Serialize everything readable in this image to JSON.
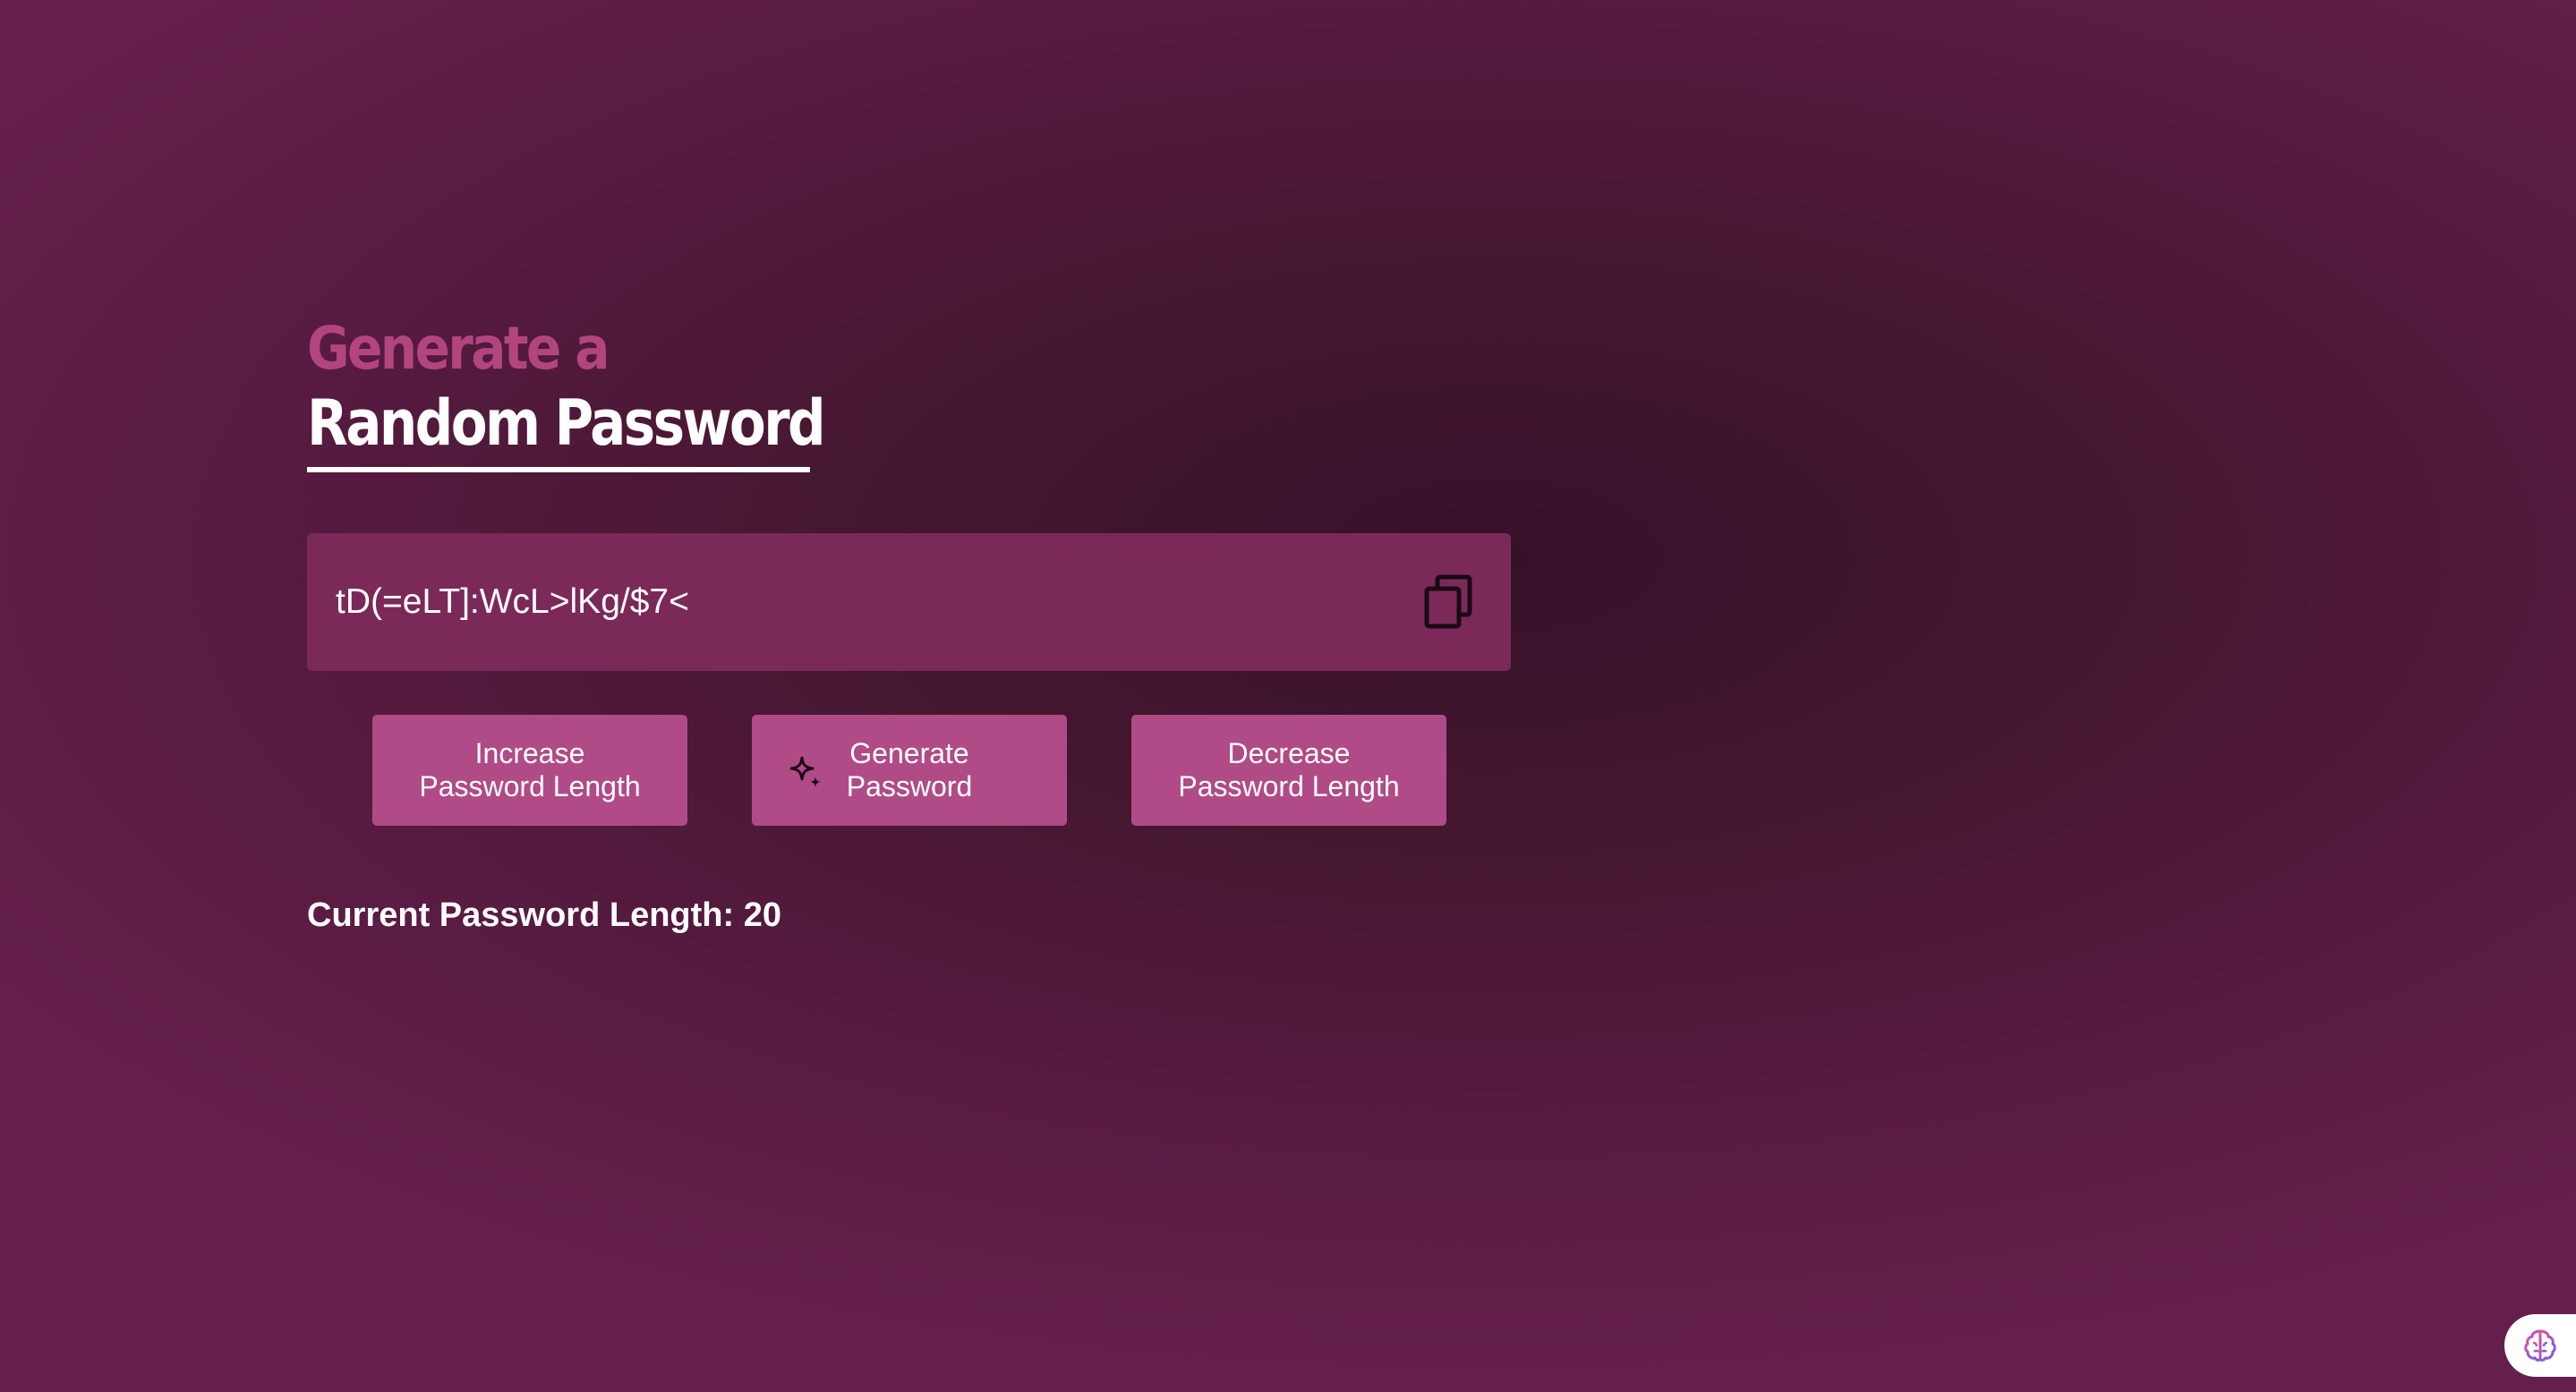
{
  "heading": {
    "line1": "Generate a",
    "line2": "Random Password"
  },
  "password": {
    "value": "tD(=eLT]:WcL>lKg/$7<"
  },
  "buttons": {
    "increase_line1": "Increase",
    "increase_line2": "Password Length",
    "generate_line1": "Generate",
    "generate_line2": "Password",
    "decrease_line1": "Decrease",
    "decrease_line2": "Password Length"
  },
  "length": {
    "text": "Current Password Length: 20"
  },
  "colors": {
    "accent_pink": "#b2457f",
    "button_bg": "#b04b87",
    "password_box_bg": "#7b2959",
    "background_dark": "#36112a"
  },
  "icons": {
    "copy": "copy-icon",
    "generate": "sparkle-icon",
    "badge": "brain-icon"
  }
}
